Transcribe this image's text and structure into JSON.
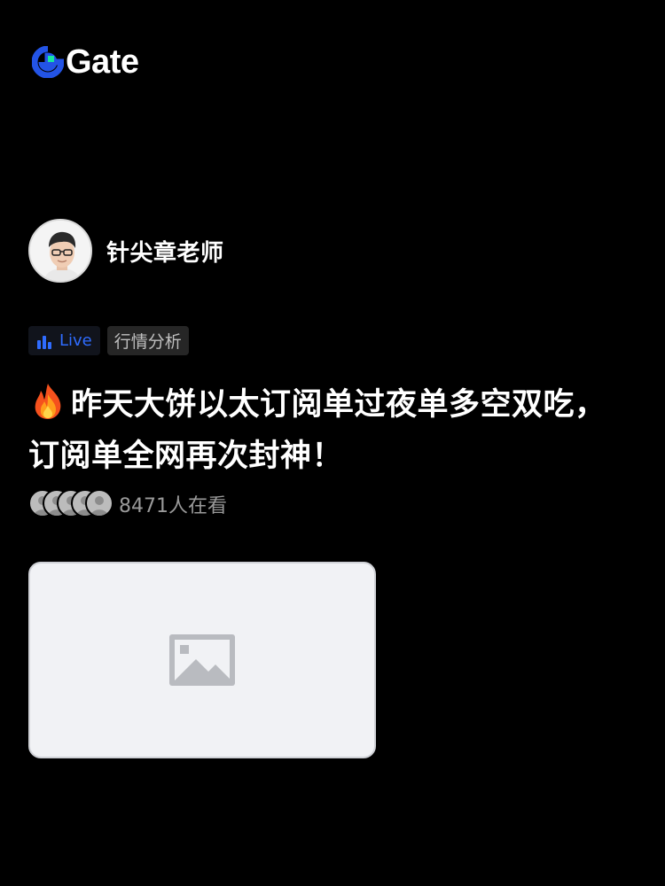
{
  "brand": {
    "name": "Gate",
    "accent": "#2354E6",
    "accent2": "#17E6A1"
  },
  "author": {
    "name": "针尖章老师"
  },
  "tags": {
    "live": "Live",
    "category": "行情分析",
    "live_color": "#2f6cff"
  },
  "post": {
    "title": "昨天大饼以太订阅单过夜单多空双吃，订阅单全网再次封神！",
    "icon": "fire-icon"
  },
  "viewers": {
    "count_text": "8471人在看"
  },
  "media": {
    "icon": "image-placeholder-icon"
  }
}
